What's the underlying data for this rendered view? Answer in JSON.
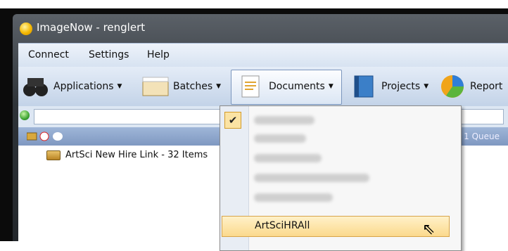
{
  "window": {
    "title": "ImageNow - renglert"
  },
  "menu": {
    "items": [
      "Connect",
      "Settings",
      "Help"
    ]
  },
  "toolbar": {
    "applications": "Applications",
    "batches": "Batches",
    "documents": "Documents",
    "projects": "Projects",
    "reports": "Report"
  },
  "panel": {
    "queue_item": "ArtSci New Hire Link - 32 Items",
    "queues_count": "1 Queue"
  },
  "dropdown": {
    "highlighted_item": "ArtSciHRAll"
  },
  "icons": {
    "checked": "check-icon"
  }
}
